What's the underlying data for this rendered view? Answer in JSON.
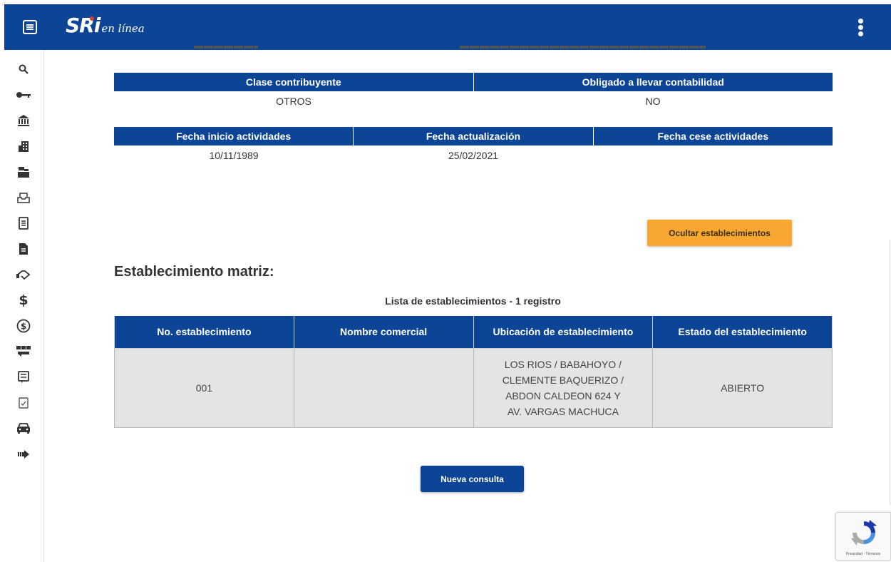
{
  "header": {
    "logo_text": "SRi",
    "logo_subtext": "en línea",
    "menu_icon": "hamburger-icon",
    "more_icon": "kebab-icon",
    "brand_color": "#0d4596"
  },
  "sidebar": {
    "icons": [
      "search-icon",
      "key-icon",
      "bank-icon",
      "building-icon",
      "cash-register-icon",
      "inbox-icon",
      "document-list-icon",
      "document-icon",
      "handshake-icon",
      "dollar-icon",
      "dollar-circle-icon",
      "money-transfer-icon",
      "receipt-icon",
      "checked-document-icon",
      "car-icon",
      "arrow-right-icon"
    ]
  },
  "taxpayer": {
    "clase_header": "Clase contribuyente",
    "contabilidad_header": "Obligado a llevar contabilidad",
    "clase_value": "OTROS",
    "contabilidad_value": "NO",
    "fecha_inicio_header": "Fecha inicio actividades",
    "fecha_actualizacion_header": "Fecha actualización",
    "fecha_cese_header": "Fecha cese actividades",
    "fecha_inicio_value": "10/11/1989",
    "fecha_actualizacion_value": "25/02/2021",
    "fecha_cese_value": ""
  },
  "actions": {
    "hide_establishments": "Ocultar establecimientos",
    "new_query": "Nueva consulta",
    "hide_color": "#f8a730"
  },
  "establishments": {
    "section_title": "Establecimiento matriz:",
    "caption": "Lista de establecimientos - 1 registro",
    "columns": [
      "No. establecimiento",
      "Nombre comercial",
      "Ubicación de establecimiento",
      "Estado del establecimiento"
    ],
    "rows": [
      {
        "numero": "001",
        "nombre": "",
        "ubicacion": "LOS RIOS / BABAHOYO / CLEMENTE BAQUERIZO / ABDON CALDEON 624 Y AV. VARGAS MACHUCA",
        "estado": "ABIERTO"
      }
    ]
  },
  "recaptcha": {
    "terms": "Privacidad - Términos"
  }
}
